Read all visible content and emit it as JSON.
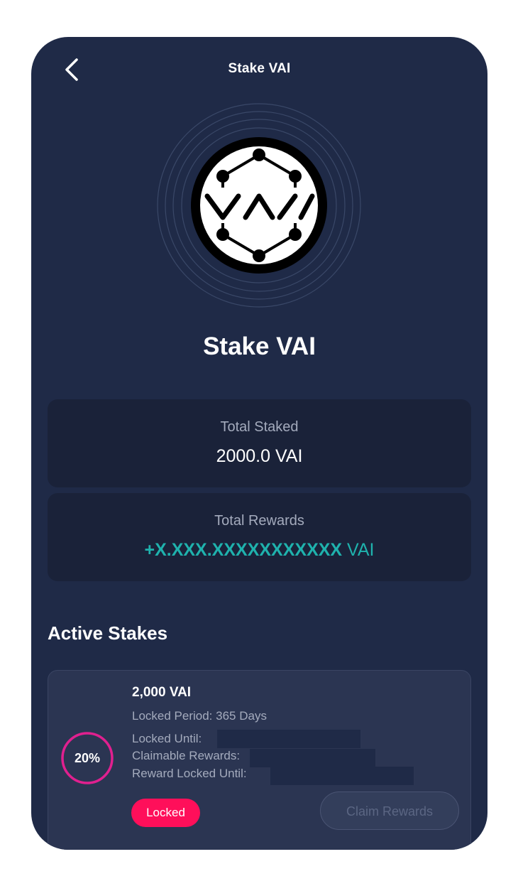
{
  "header": {
    "title": "Stake VAI",
    "back_icon": "chevron-left-icon"
  },
  "logo": {
    "text": "VAI",
    "icon": "vai-token-logo"
  },
  "main_title": "Stake VAI",
  "summary": {
    "total_staked_label": "Total Staked",
    "total_staked_value": "2000.0 VAI",
    "total_rewards_label": "Total Rewards",
    "total_rewards_amount": "+X.XXX.XXXXXXXXXXX",
    "total_rewards_unit": " VAI"
  },
  "active_stakes": {
    "title": "Active Stakes",
    "items": [
      {
        "progress_label": "20%",
        "progress": 0.2,
        "amount": "2,000 VAI",
        "locked_period": "Locked Period: 365 Days",
        "locked_until": "Locked Until:",
        "claimable_rewards": "Claimable Rewards:",
        "reward_locked_until": "Reward Locked Until:",
        "status_badge": "Locked",
        "claim_button": "Claim Rewards"
      }
    ]
  },
  "colors": {
    "background": "#1f2a47",
    "card": "#1a2239",
    "accent_teal": "#1fb2ad",
    "badge_red": "#ff0f5a",
    "ring_pink": "#e0208f"
  }
}
